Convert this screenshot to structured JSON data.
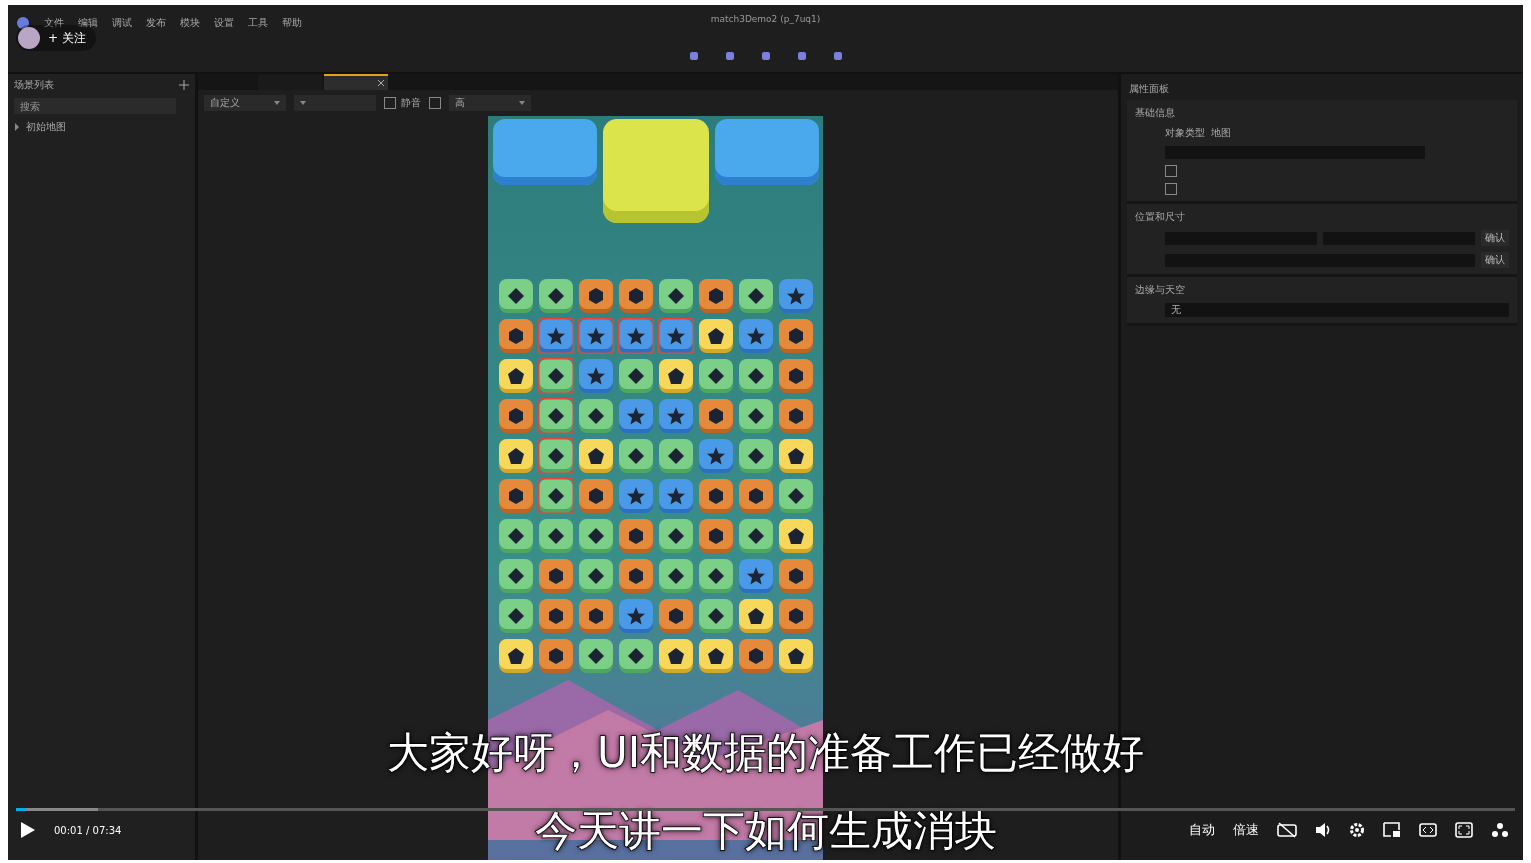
{
  "editor": {
    "menu": [
      "文件",
      "编辑",
      "调试",
      "发布",
      "模块",
      "设置",
      "工具",
      "帮助"
    ],
    "title": "match3Demo2 (p_7uq1)",
    "left_panel": {
      "title": "场景列表",
      "search": {
        "placeholder": "搜索"
      },
      "tree": [
        {
          "label": "初始地图",
          "expanded": false
        }
      ]
    },
    "tabs": [
      {
        "selected": false
      },
      {
        "selected": true
      }
    ],
    "canvas_toolbar": [
      {
        "kind": "dropdown",
        "label": "自定义"
      },
      {
        "kind": "dropdown"
      },
      {
        "kind": "checkbox",
        "label": "静音",
        "checked": false
      },
      {
        "kind": "checkbox",
        "checked": false
      },
      {
        "kind": "dropdown",
        "label": "高"
      }
    ],
    "board": {
      "rows": [
        {
          "tiles": [
            {
              "kind": "green",
              "selected": false
            },
            {
              "kind": "green",
              "selected": false
            },
            {
              "kind": "orange",
              "selected": false
            },
            {
              "kind": "orange",
              "selected": false
            },
            {
              "kind": "green",
              "selected": false
            },
            {
              "kind": "orange",
              "selected": false
            },
            {
              "kind": "green",
              "selected": false
            },
            {
              "kind": "blue",
              "selected": false
            }
          ]
        },
        {
          "tiles": [
            {
              "kind": "orange",
              "selected": false
            },
            {
              "kind": "blue",
              "selected": true
            },
            {
              "kind": "blue",
              "selected": true
            },
            {
              "kind": "blue",
              "selected": true
            },
            {
              "kind": "blue",
              "selected": true
            },
            {
              "kind": "yellow",
              "selected": false
            },
            {
              "kind": "blue",
              "selected": false
            },
            {
              "kind": "orange",
              "selected": false
            }
          ]
        },
        {
          "tiles": [
            {
              "kind": "yellow",
              "selected": false
            },
            {
              "kind": "green",
              "selected": true
            },
            {
              "kind": "blue",
              "selected": false
            },
            {
              "kind": "green",
              "selected": false
            },
            {
              "kind": "yellow",
              "selected": false
            },
            {
              "kind": "green",
              "selected": false
            },
            {
              "kind": "green",
              "selected": false
            },
            {
              "kind": "orange",
              "selected": false
            }
          ]
        },
        {
          "tiles": [
            {
              "kind": "orange",
              "selected": false
            },
            {
              "kind": "green",
              "selected": true
            },
            {
              "kind": "green",
              "selected": false
            },
            {
              "kind": "blue",
              "selected": false
            },
            {
              "kind": "blue",
              "selected": false
            },
            {
              "kind": "orange",
              "selected": false
            },
            {
              "kind": "green",
              "selected": false
            },
            {
              "kind": "orange",
              "selected": false
            }
          ]
        },
        {
          "tiles": [
            {
              "kind": "yellow",
              "selected": false
            },
            {
              "kind": "green",
              "selected": true
            },
            {
              "kind": "yellow",
              "selected": false
            },
            {
              "kind": "green",
              "selected": false
            },
            {
              "kind": "green",
              "selected": false
            },
            {
              "kind": "blue",
              "selected": false
            },
            {
              "kind": "green",
              "selected": false
            },
            {
              "kind": "yellow",
              "selected": false
            }
          ]
        },
        {
          "tiles": [
            {
              "kind": "orange",
              "selected": false
            },
            {
              "kind": "green",
              "selected": true
            },
            {
              "kind": "orange",
              "selected": false
            },
            {
              "kind": "blue",
              "selected": false
            },
            {
              "kind": "blue",
              "selected": false
            },
            {
              "kind": "orange",
              "selected": false
            },
            {
              "kind": "orange",
              "selected": false
            },
            {
              "kind": "green",
              "selected": false
            }
          ]
        },
        {
          "tiles": [
            {
              "kind": "green",
              "selected": false
            },
            {
              "kind": "green",
              "selected": false
            },
            {
              "kind": "green",
              "selected": false
            },
            {
              "kind": "orange",
              "selected": false
            },
            {
              "kind": "green",
              "selected": false
            },
            {
              "kind": "orange",
              "selected": false
            },
            {
              "kind": "green",
              "selected": false
            },
            {
              "kind": "yellow",
              "selected": false
            }
          ]
        },
        {
          "tiles": [
            {
              "kind": "green",
              "selected": false
            },
            {
              "kind": "orange",
              "selected": false
            },
            {
              "kind": "green",
              "selected": false
            },
            {
              "kind": "orange",
              "selected": false
            },
            {
              "kind": "green",
              "selected": false
            },
            {
              "kind": "green",
              "selected": false
            },
            {
              "kind": "blue",
              "selected": false
            },
            {
              "kind": "orange",
              "selected": false
            }
          ]
        },
        {
          "tiles": [
            {
              "kind": "green",
              "selected": false
            },
            {
              "kind": "orange",
              "selected": false
            },
            {
              "kind": "orange",
              "selected": false
            },
            {
              "kind": "blue",
              "selected": false
            },
            {
              "kind": "orange",
              "selected": false
            },
            {
              "kind": "green",
              "selected": false
            },
            {
              "kind": "yellow",
              "selected": false
            },
            {
              "kind": "orange",
              "selected": false
            }
          ]
        },
        {
          "tiles": [
            {
              "kind": "yellow",
              "selected": false
            },
            {
              "kind": "orange",
              "selected": false
            },
            {
              "kind": "green",
              "selected": false
            },
            {
              "kind": "green",
              "selected": false
            },
            {
              "kind": "yellow",
              "selected": false
            },
            {
              "kind": "yellow",
              "selected": false
            },
            {
              "kind": "orange",
              "selected": false
            },
            {
              "kind": "yellow",
              "selected": false
            }
          ]
        }
      ]
    },
    "properties": {
      "title": "属性面板",
      "sections": [
        {
          "title": "基础信息",
          "fields": [
            {
              "kind": "text",
              "label": "对象类型",
              "value": "地图"
            },
            {
              "kind": "input"
            },
            {
              "kind": "checkbox",
              "checked": false
            },
            {
              "kind": "checkbox",
              "checked": false
            }
          ]
        },
        {
          "title": "位置和尺寸",
          "fields": [
            {
              "kind": "pair",
              "button": "确认"
            },
            {
              "kind": "input_confirm",
              "button": "确认"
            }
          ]
        },
        {
          "title": "边缘与天空",
          "fields": [
            {
              "kind": "select",
              "value": "无"
            }
          ]
        }
      ]
    }
  },
  "player": {
    "follow": "+ 关注",
    "subtitles": [
      "大家好呀，UI和数据的准备工作已经做好",
      "今天讲一下如何生成消块"
    ],
    "progress": {
      "level": 0.006
    },
    "buffer": {
      "level": 0.055
    },
    "playing": false,
    "time": "00:01 / 07:34",
    "quality": "自动",
    "speed": "倍速"
  }
}
